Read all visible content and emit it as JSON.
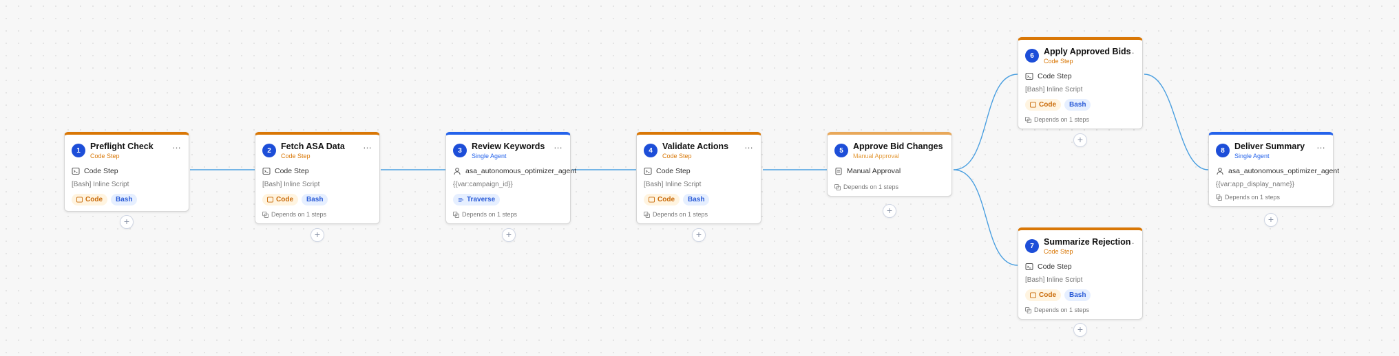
{
  "accent": {
    "code": "#d97706",
    "agent": "#2563eb",
    "manual": "#e8a85a",
    "edge": "#4a9fe0"
  },
  "nodes": [
    {
      "number": "1",
      "title": "Preflight Check",
      "subtitle": "Code Step",
      "row_label": "Code Step",
      "row_icon": "terminal-icon",
      "detail": "[Bash] Inline Script",
      "tags": [
        "Code",
        "Bash"
      ]
    },
    {
      "number": "2",
      "title": "Fetch ASA Data",
      "subtitle": "Code Step",
      "row_label": "Code Step",
      "row_icon": "terminal-icon",
      "detail": "[Bash] Inline Script",
      "tags": [
        "Code",
        "Bash"
      ],
      "depends": "Depends on 1 steps"
    },
    {
      "number": "3",
      "title": "Review Keywords",
      "subtitle": "Single Agent",
      "row_label": "asa_autonomous_optimizer_agent",
      "row_icon": "user-icon",
      "detail": "{{var:campaign_id}}",
      "traverse": "Traverse",
      "depends": "Depends on 1 steps"
    },
    {
      "number": "4",
      "title": "Validate Actions",
      "subtitle": "Code Step",
      "row_label": "Code Step",
      "row_icon": "terminal-icon",
      "detail": "[Bash] Inline Script",
      "tags": [
        "Code",
        "Bash"
      ],
      "depends": "Depends on 1 steps"
    },
    {
      "number": "5",
      "title": "Approve Bid Changes",
      "subtitle": "Manual Approval",
      "row_label": "Manual Approval",
      "row_icon": "clipboard-icon",
      "depends": "Depends on 1 steps"
    },
    {
      "number": "6",
      "title": "Apply Approved Bids",
      "subtitle": "Code Step",
      "row_label": "Code Step",
      "row_icon": "terminal-icon",
      "detail": "[Bash] Inline Script",
      "tags": [
        "Code",
        "Bash"
      ],
      "depends": "Depends on 1 steps"
    },
    {
      "number": "7",
      "title": "Summarize Rejection",
      "subtitle": "Code Step",
      "row_label": "Code Step",
      "row_icon": "terminal-icon",
      "detail": "[Bash] Inline Script",
      "tags": [
        "Code",
        "Bash"
      ],
      "depends": "Depends on 1 steps"
    },
    {
      "number": "8",
      "title": "Deliver Summary",
      "subtitle": "Single Agent",
      "row_label": "asa_autonomous_optimizer_agent",
      "row_icon": "user-icon",
      "detail": "{{var:app_display_name}}",
      "depends": "Depends on 1 steps"
    }
  ],
  "menu_glyph": "…",
  "add_glyph": "+"
}
